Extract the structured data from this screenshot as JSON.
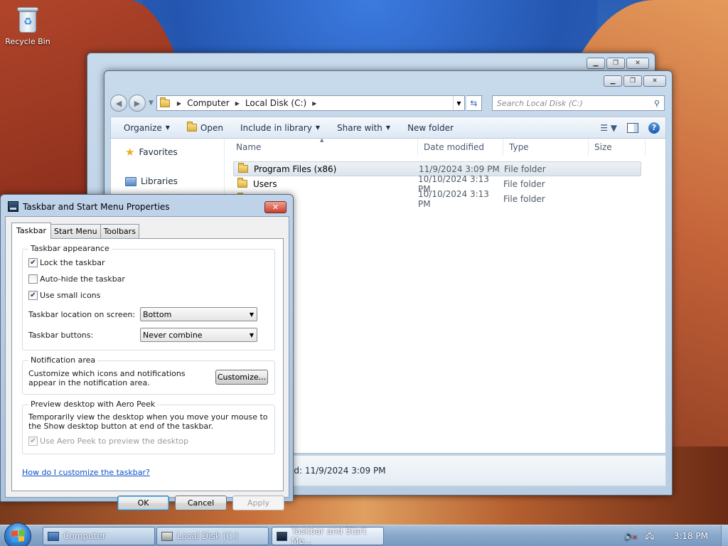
{
  "desktop": {
    "recycle_bin_label": "Recycle Bin"
  },
  "explorer": {
    "address": {
      "crumbs": [
        "Computer",
        "Local Disk (C:)"
      ]
    },
    "search_placeholder": "Search Local Disk (C:)",
    "commands": {
      "organize": "Organize",
      "open": "Open",
      "include_in_library": "Include in library",
      "share_with": "Share with",
      "new_folder": "New folder"
    },
    "nav_pane": {
      "favorites": "Favorites",
      "libraries": "Libraries"
    },
    "columns": {
      "name": "Name",
      "date_modified": "Date modified",
      "type": "Type",
      "size": "Size"
    },
    "files": [
      {
        "name": "Program Files (x86)",
        "date": "11/9/2024 3:09 PM",
        "type": "File folder",
        "selected": true
      },
      {
        "name": "Users",
        "date": "10/10/2024 3:13 PM",
        "type": "File folder",
        "selected": false
      },
      {
        "name": "",
        "date": "10/10/2024 3:13 PM",
        "type": "File folder",
        "selected": false
      }
    ],
    "details_text": "ed: 11/9/2024 3:09 PM"
  },
  "dialog": {
    "title": "Taskbar and Start Menu Properties",
    "tabs": [
      "Taskbar",
      "Start Menu",
      "Toolbars"
    ],
    "active_tab": "Taskbar",
    "appearance": {
      "group_label": "Taskbar appearance",
      "lock_taskbar": {
        "label": "Lock the taskbar",
        "checked": true
      },
      "auto_hide": {
        "label": "Auto-hide the taskbar",
        "checked": false
      },
      "small_icons": {
        "label": "Use small icons",
        "checked": true
      },
      "location_label": "Taskbar location on screen:",
      "location_value": "Bottom",
      "buttons_label": "Taskbar buttons:",
      "buttons_value": "Never combine"
    },
    "notification": {
      "group_label": "Notification area",
      "text": "Customize which icons and notifications appear in the notification area.",
      "customize_button": "Customize..."
    },
    "aero_peek": {
      "group_label": "Preview desktop with Aero Peek",
      "text": "Temporarily view the desktop when you move your mouse to the Show desktop button at end of the taskbar.",
      "checkbox_label": "Use Aero Peek to preview the desktop",
      "checked": true,
      "disabled": true
    },
    "help_link": "How do I customize the taskbar?",
    "buttons": {
      "ok": "OK",
      "cancel": "Cancel",
      "apply": "Apply"
    }
  },
  "taskbar": {
    "buttons": [
      {
        "label": "Computer",
        "icon": "computer-icon"
      },
      {
        "label": "Local Disk (C:)",
        "icon": "drive-icon"
      },
      {
        "label": "Taskbar and Start Me...",
        "icon": "properties-icon"
      }
    ],
    "clock": "3:18 PM"
  }
}
